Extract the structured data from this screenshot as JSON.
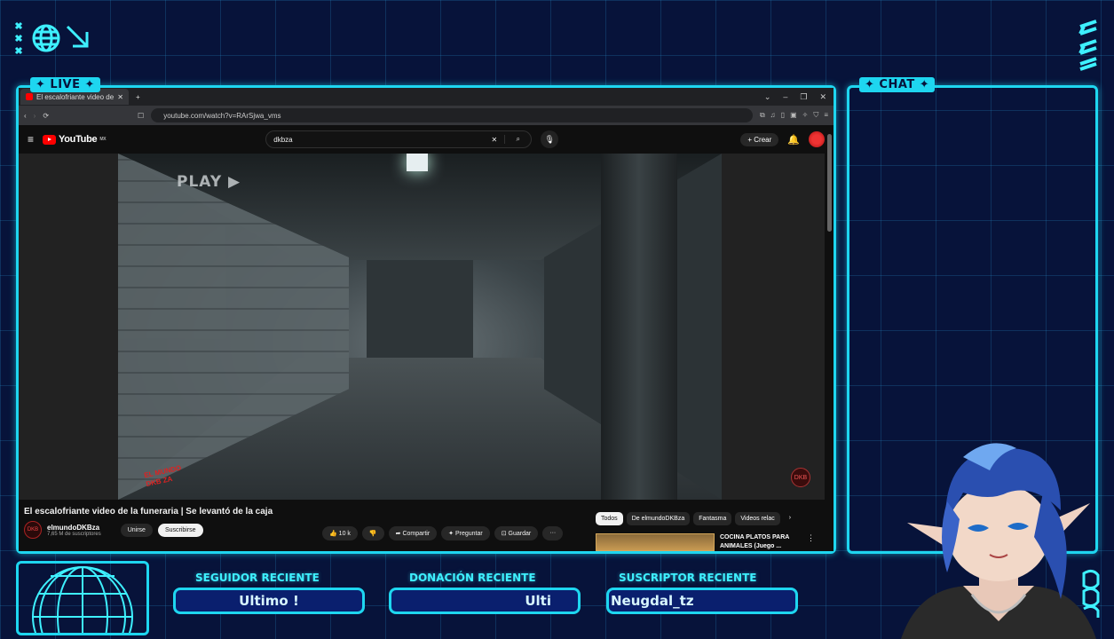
{
  "overlay": {
    "live_tag": "✦ LIVE ✦",
    "chat_tag": "✦ CHAT ✦",
    "stats": [
      {
        "label": "SEGUIDOR RECIENTE",
        "value": "Ultimo !"
      },
      {
        "label": "DONACIÓN RECIENTE",
        "value": "Ulti"
      },
      {
        "label": "SUSCRIPTOR RECIENTE",
        "value": "Neugdal_tz"
      }
    ],
    "accent_color": "#1ed6f0",
    "background_color": "#07133a"
  },
  "browser": {
    "tab_title": "El escalofriante video de la fu",
    "new_tab": "+",
    "url": "youtube.com/watch?v=RArSjwa_vms",
    "window_controls": [
      "⌄",
      "–",
      "❐",
      "✕"
    ]
  },
  "youtube": {
    "logo_text": "YouTube",
    "region": "MX",
    "search_query": "dkbza",
    "create_label": "Crear",
    "player": {
      "overlay_text": "PLAY ▶",
      "watermark_left": "EL MUNDO DKB ZA",
      "watermark_right": "DKB"
    },
    "video": {
      "title": "El escalofriante video de la funeraria | Se levantó de la caja",
      "channel": "elmundoDKBza",
      "subscribers": "7,65 M de suscriptores",
      "join_label": "Unirse",
      "subscribe_label": "Suscribirse",
      "likes": "10 k",
      "share_label": "Compartir",
      "ask_label": "Preguntar",
      "save_label": "Guardar",
      "more_label": "···"
    },
    "chips": [
      "Todos",
      "De elmundoDKBza",
      "Fantasma",
      "Videos relac"
    ],
    "recommendation": {
      "title": "COCINA PLATOS PARA ANIMALES (Juego ..."
    }
  }
}
